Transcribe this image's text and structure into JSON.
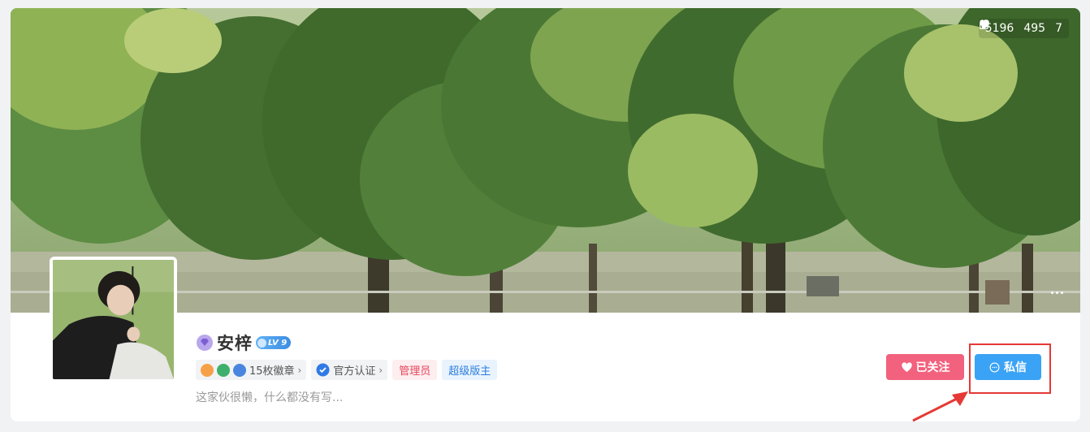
{
  "stats": {
    "hot": "5196",
    "likes": "495",
    "favorites": "7"
  },
  "profile": {
    "username": "安梓",
    "level": "LV 9",
    "medals_label": "15枚徽章",
    "certified_label": "官方认证",
    "role_admin": "管理员",
    "role_moderator": "超级版主",
    "bio": "这家伙很懒，什么都没有写..."
  },
  "actions": {
    "follow_label": "已关注",
    "message_label": "私信"
  },
  "colors": {
    "follow_bg": "#f2617d",
    "message_bg": "#3aa3f5",
    "admin_text": "#e8465b",
    "moderator_text": "#2a7ddc",
    "annotation": "#e53935"
  },
  "icons": [
    "fire-icon",
    "thumbs-up-icon",
    "heart-icon",
    "more-icon",
    "vip-gem-icon",
    "level-badge-icon",
    "medal-icon",
    "verified-icon",
    "chevron-right-icon",
    "chat-icon"
  ]
}
